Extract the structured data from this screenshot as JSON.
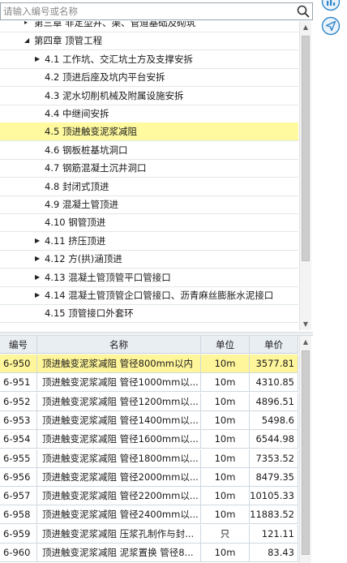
{
  "search": {
    "placeholder": "请输入编号或名称"
  },
  "icons": {
    "search": "search-icon",
    "chart": "chart-icon",
    "navigate": "navigate-icon"
  },
  "colors": {
    "selected_tree": "#fffaa0",
    "selected_row": "#fff59a",
    "accent": "#2f86c8"
  },
  "tree": {
    "items": [
      {
        "label": "第三章 非定型井、渠、管道基础及砌筑",
        "level": 1,
        "arrow": "▸"
      },
      {
        "label": "第四章 顶管工程",
        "level": 1,
        "arrow": "◢"
      },
      {
        "label": "4.1 工作坑、交汇坑土方及支撑安拆",
        "level": 2,
        "arrow": "▶"
      },
      {
        "label": "4.2 顶进后座及坑内平台安拆",
        "level": 2,
        "arrow": ""
      },
      {
        "label": "4.3 泥水切削机械及附属设施安拆",
        "level": 2,
        "arrow": ""
      },
      {
        "label": "4.4 中继间安拆",
        "level": 2,
        "arrow": ""
      },
      {
        "label": "4.5 顶进触变泥浆减阻",
        "level": 2,
        "arrow": "",
        "selected": true
      },
      {
        "label": "4.6 钢板桩基坑洞口",
        "level": 2,
        "arrow": ""
      },
      {
        "label": "4.7 钢筋混凝土沉井洞口",
        "level": 2,
        "arrow": ""
      },
      {
        "label": "4.8 封闭式顶进",
        "level": 2,
        "arrow": ""
      },
      {
        "label": "4.9 混凝土管顶进",
        "level": 2,
        "arrow": ""
      },
      {
        "label": "4.10 钢管顶进",
        "level": 2,
        "arrow": ""
      },
      {
        "label": "4.11 挤压顶进",
        "level": 2,
        "arrow": "▶"
      },
      {
        "label": "4.12 方(拱)涵顶进",
        "level": 2,
        "arrow": "▶"
      },
      {
        "label": "4.13 混凝土管顶管平口管接口",
        "level": 2,
        "arrow": "▶"
      },
      {
        "label": "4.14 混凝土管顶管企口管接口、沥青麻丝膨胀水泥接口",
        "level": 2,
        "arrow": "▶"
      },
      {
        "label": "4.15 顶管接口外套环",
        "level": 2,
        "arrow": ""
      }
    ]
  },
  "table": {
    "headers": {
      "code": "编号",
      "name": "名称",
      "unit": "单位",
      "price": "单价"
    },
    "rows": [
      {
        "code": "6-950",
        "name": "顶进触变泥浆减阻 管径800mm以内",
        "unit": "10m",
        "price": "3577.81",
        "selected": true
      },
      {
        "code": "6-951",
        "name": "顶进触变泥浆减阻 管径1000mm以...",
        "unit": "10m",
        "price": "4310.85"
      },
      {
        "code": "6-952",
        "name": "顶进触变泥浆减阻 管径1200mm以...",
        "unit": "10m",
        "price": "4896.51"
      },
      {
        "code": "6-953",
        "name": "顶进触变泥浆减阻 管径1400mm以...",
        "unit": "10m",
        "price": "5498.6"
      },
      {
        "code": "6-954",
        "name": "顶进触变泥浆减阻 管径1600mm以...",
        "unit": "10m",
        "price": "6544.98"
      },
      {
        "code": "6-955",
        "name": "顶进触变泥浆减阻 管径1800mm以...",
        "unit": "10m",
        "price": "7353.52"
      },
      {
        "code": "6-956",
        "name": "顶进触变泥浆减阻 管径2000mm以...",
        "unit": "10m",
        "price": "8479.35"
      },
      {
        "code": "6-957",
        "name": "顶进触变泥浆减阻 管径2200mm以...",
        "unit": "10m",
        "price": "10105.33"
      },
      {
        "code": "6-958",
        "name": "顶进触变泥浆减阻 管径2400mm以...",
        "unit": "10m",
        "price": "11883.52"
      },
      {
        "code": "6-959",
        "name": "顶进触变泥浆减阻 压浆孔制作与封...",
        "unit": "只",
        "price": "121.11"
      },
      {
        "code": "6-960",
        "name": "顶进触变泥浆减阻 泥浆置换 管径8...",
        "unit": "10m",
        "price": "83.43"
      }
    ]
  }
}
